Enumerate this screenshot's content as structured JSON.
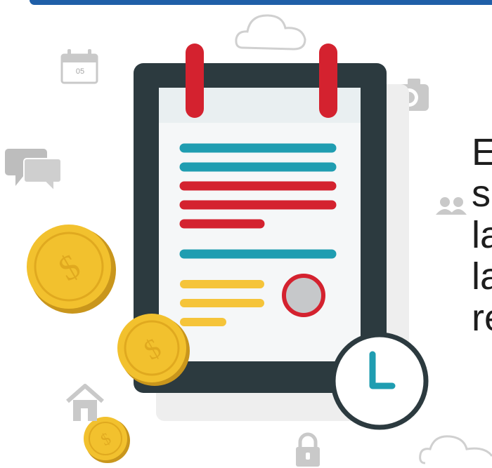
{
  "calendar": {
    "day": "05"
  },
  "side_text": {
    "lines": [
      "E",
      "s",
      "la",
      "la",
      "re"
    ]
  },
  "icons": {
    "calendar": "calendar-icon",
    "cloud": "cloud-icon",
    "camera": "camera-icon",
    "chat": "chat-bubbles-icon",
    "users": "users-icon",
    "home": "home-icon",
    "lock": "lock-icon",
    "coin": "dollar-coin-icon",
    "clock": "clock-icon",
    "clipboard": "clipboard-icon"
  },
  "colors": {
    "teal": "#1f9db1",
    "red": "#d4222f",
    "yellow": "#f5c43a",
    "board": "#2c3a3f",
    "icon_gray": "#c9c9c9",
    "coin": "#f2c12e",
    "banner": "#1f5fa8"
  }
}
